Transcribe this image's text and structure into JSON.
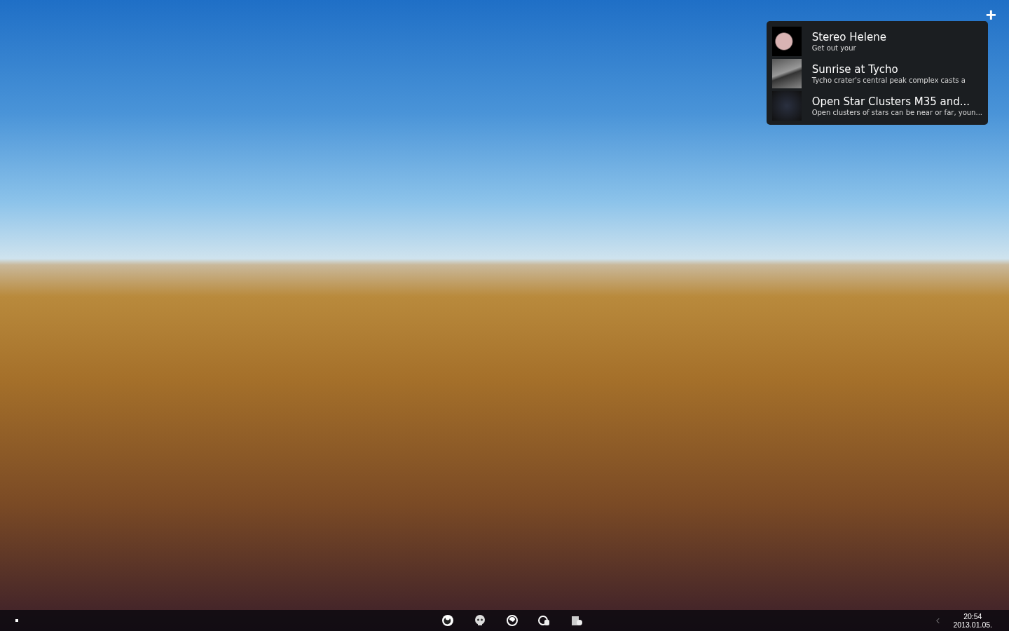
{
  "widget": {
    "add_button": "+",
    "items": [
      {
        "title": "Stereo Helene",
        "description": "Get out your"
      },
      {
        "title": "Sunrise at Tycho",
        "description": "Tycho crater's central peak complex casts a"
      },
      {
        "title": "Open Star Clusters M35 and...",
        "description": "Open clusters of stars can be near or far, youn..."
      }
    ]
  },
  "taskbar": {
    "clock": {
      "time": "20:54",
      "date": "2013.01.05."
    }
  }
}
